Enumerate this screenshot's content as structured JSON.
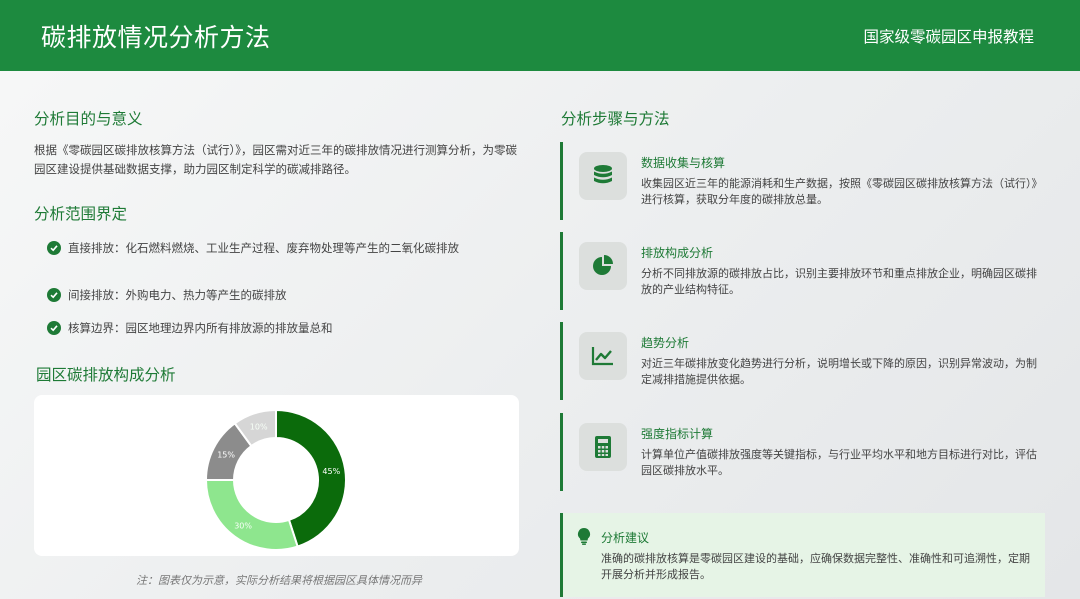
{
  "header": {
    "title": "碳排放情况分析方法",
    "subtitle": "国家级零碳园区申报教程"
  },
  "purpose": {
    "title": "分析目的与意义",
    "text": "根据《零碳园区碳排放核算方法（试行）》，园区需对近三年的碳排放情况进行测算分析，为零碳园区建设提供基础数据支撑，助力园区制定科学的碳减排路径。"
  },
  "scope": {
    "title": "分析范围界定",
    "items": [
      {
        "text": "直接排放：化石燃料燃烧、工业生产过程、废弃物处理等产生的二氧化碳排放"
      },
      {
        "text": "间接排放：外购电力、热力等产生的碳排放"
      },
      {
        "text": "核算边界：园区地理边界内所有排放源的排放量总和"
      }
    ]
  },
  "composition": {
    "title": "园区碳排放构成分析",
    "note": "注：图表仅为示意，实际分析结果将根据园区具体情况而异"
  },
  "chart_data": {
    "type": "pie",
    "variant": "donut",
    "values": [
      45,
      30,
      15,
      10
    ],
    "labels": [
      "45%",
      "30%",
      "15%",
      "10%"
    ],
    "colors": [
      "#0b6b0b",
      "#8ee68e",
      "#8c8c8c",
      "#d6d6d6"
    ],
    "legend": "none"
  },
  "steps": {
    "title": "分析步骤与方法",
    "items": [
      {
        "icon": "database-icon",
        "title": "数据收集与核算",
        "desc": "收集园区近三年的能源消耗和生产数据，按照《零碳园区碳排放核算方法（试行）》进行核算，获取分年度的碳排放总量。"
      },
      {
        "icon": "pie-chart-icon",
        "title": "排放构成分析",
        "desc": "分析不同排放源的碳排放占比，识别主要排放环节和重点排放企业，明确园区碳排放的产业结构特征。"
      },
      {
        "icon": "line-chart-icon",
        "title": "趋势分析",
        "desc": "对近三年碳排放变化趋势进行分析，说明增长或下降的原因，识别异常波动，为制定减排措施提供依据。"
      },
      {
        "icon": "calculator-icon",
        "title": "强度指标计算",
        "desc": "计算单位产值碳排放强度等关键指标，与行业平均水平和地方目标进行对比，评估园区碳排放水平。"
      }
    ]
  },
  "advice": {
    "icon": "lightbulb-icon",
    "title": "分析建议",
    "text": "准确的碳排放核算是零碳园区建设的基础，应确保数据完整性、准确性和可追溯性，定期开展分析并形成报告。"
  }
}
